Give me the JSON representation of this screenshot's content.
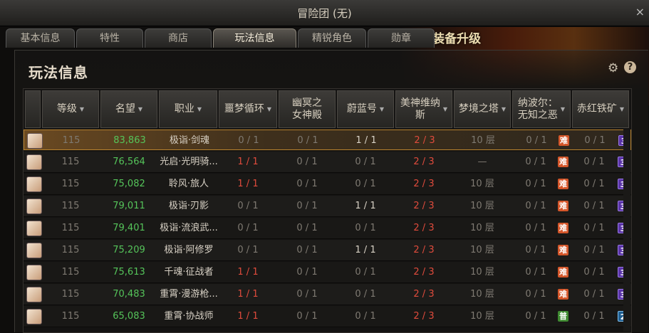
{
  "window": {
    "title": "冒险团 (无)",
    "close": "×"
  },
  "tabs": [
    "基本信息",
    "特性",
    "商店",
    "玩法信息",
    "精锐角色",
    "勋章"
  ],
  "promo_text": "装备升级",
  "panel_title": "玩法信息",
  "icons": {
    "gear": "⚙",
    "help": "?"
  },
  "columns": [
    "等级",
    "名望",
    "职业",
    "噩梦循环",
    "幽冥之\n女神殿",
    "蔚蓝号",
    "美神维纳\n斯",
    "梦境之塔",
    "纳波尔：\n无知之恶",
    "赤红铁矿"
  ],
  "rows": [
    {
      "level": "115",
      "fame": "83,863",
      "job": "极诣·剑魂",
      "nightmare": "0 / 1",
      "temple": "0 / 1",
      "blue": "1 / 1",
      "venus": "2 / 3",
      "tower": "10 层",
      "nabol": "0 / 1",
      "nabol_badge": "难",
      "iron": "0 / 1",
      "iron_badge": "3"
    },
    {
      "level": "115",
      "fame": "76,564",
      "job": "光启·光明骑...",
      "nightmare": "1 / 1",
      "temple": "0 / 1",
      "blue": "0 / 1",
      "venus": "2 / 3",
      "tower": "—",
      "nabol": "0 / 1",
      "nabol_badge": "难",
      "iron": "0 / 1",
      "iron_badge": "3"
    },
    {
      "level": "115",
      "fame": "75,082",
      "job": "聆风·旅人",
      "nightmare": "1 / 1",
      "temple": "0 / 1",
      "blue": "0 / 1",
      "venus": "2 / 3",
      "tower": "10 层",
      "nabol": "0 / 1",
      "nabol_badge": "难",
      "iron": "0 / 1",
      "iron_badge": "3"
    },
    {
      "level": "115",
      "fame": "79,011",
      "job": "极诣·刃影",
      "nightmare": "0 / 1",
      "temple": "0 / 1",
      "blue": "1 / 1",
      "venus": "2 / 3",
      "tower": "10 层",
      "nabol": "0 / 1",
      "nabol_badge": "难",
      "iron": "0 / 1",
      "iron_badge": "3"
    },
    {
      "level": "115",
      "fame": "79,401",
      "job": "极诣·流浪武...",
      "nightmare": "0 / 1",
      "temple": "0 / 1",
      "blue": "0 / 1",
      "venus": "2 / 3",
      "tower": "10 层",
      "nabol": "0 / 1",
      "nabol_badge": "难",
      "iron": "0 / 1",
      "iron_badge": "3"
    },
    {
      "level": "115",
      "fame": "75,209",
      "job": "极诣·阿修罗",
      "nightmare": "0 / 1",
      "temple": "0 / 1",
      "blue": "1 / 1",
      "venus": "2 / 3",
      "tower": "10 层",
      "nabol": "0 / 1",
      "nabol_badge": "难",
      "iron": "0 / 1",
      "iron_badge": "3"
    },
    {
      "level": "115",
      "fame": "75,613",
      "job": "千魂·征战者",
      "nightmare": "1 / 1",
      "temple": "0 / 1",
      "blue": "0 / 1",
      "venus": "2 / 3",
      "tower": "10 层",
      "nabol": "0 / 1",
      "nabol_badge": "难",
      "iron": "0 / 1",
      "iron_badge": "3"
    },
    {
      "level": "115",
      "fame": "70,483",
      "job": "重霄·漫游枪...",
      "nightmare": "1 / 1",
      "temple": "0 / 1",
      "blue": "0 / 1",
      "venus": "2 / 3",
      "tower": "10 层",
      "nabol": "0 / 1",
      "nabol_badge": "难",
      "iron": "0 / 1",
      "iron_badge": "3"
    },
    {
      "level": "115",
      "fame": "65,083",
      "job": "重霄·协战师",
      "nightmare": "1 / 1",
      "temple": "0 / 1",
      "blue": "0 / 1",
      "venus": "2 / 3",
      "tower": "10 层",
      "nabol": "0 / 1",
      "nabol_badge": "普",
      "iron": "0 / 1",
      "iron_badge": "2"
    }
  ],
  "colors": {
    "fame": "#55c45a",
    "red": "#e04b3c",
    "gold": "#b9832e"
  }
}
